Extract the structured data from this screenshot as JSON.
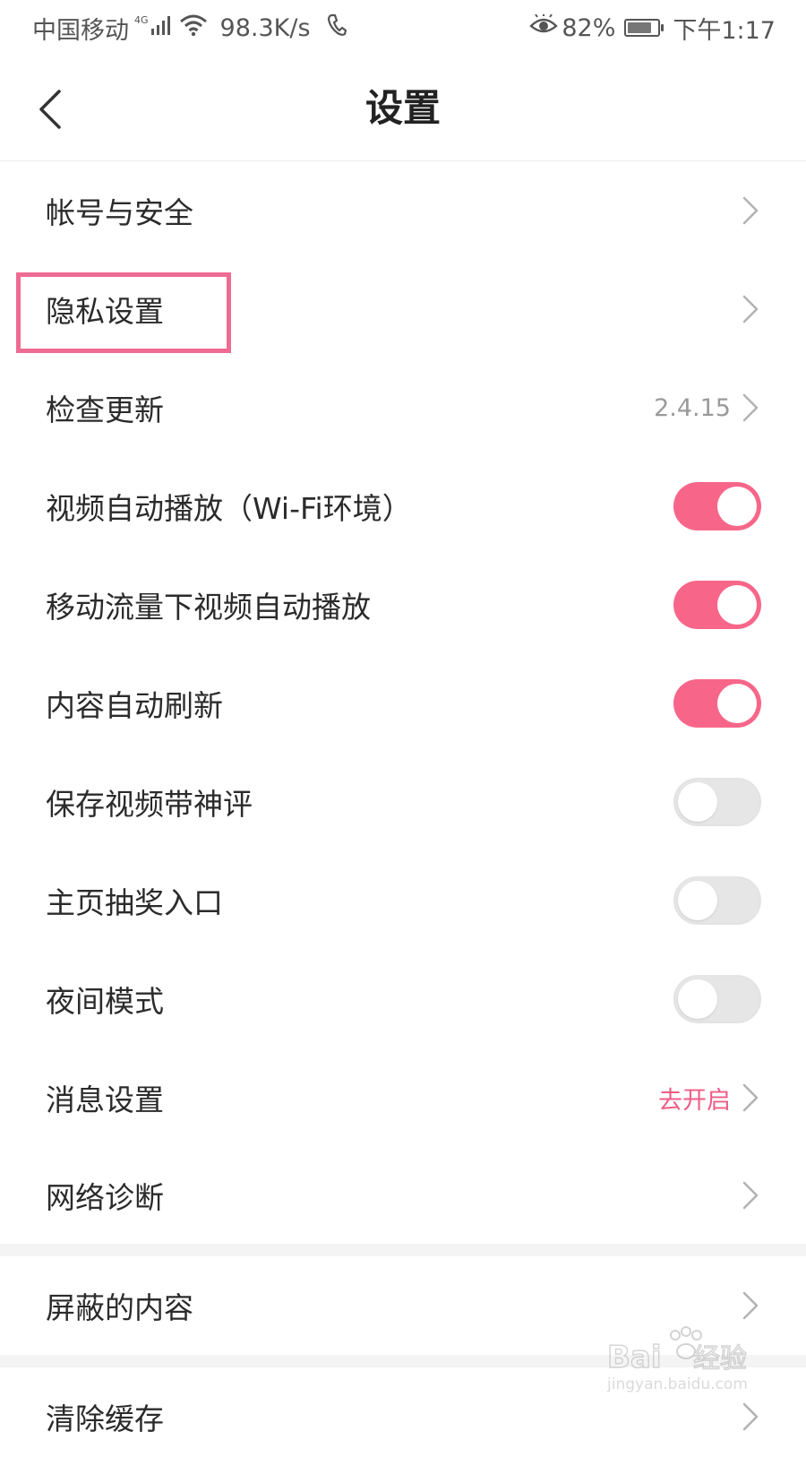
{
  "status_bar": {
    "carrier": "中国移动",
    "network_badge": "4G",
    "speed": "98.3K/s",
    "battery": "82%",
    "battery_level": 0.82,
    "time": "下午1:17"
  },
  "header": {
    "title": "设置"
  },
  "settings": {
    "account": {
      "label": "帐号与安全"
    },
    "privacy": {
      "label": "隐私设置"
    },
    "update": {
      "label": "检查更新",
      "value": "2.4.15"
    },
    "autoplay_wifi": {
      "label": "视频自动播放（Wi-Fi环境）",
      "enabled": true
    },
    "autoplay_mobile": {
      "label": "移动流量下视频自动播放",
      "enabled": true
    },
    "auto_refresh": {
      "label": "内容自动刷新",
      "enabled": true
    },
    "save_with_comments": {
      "label": "保存视频带神评",
      "enabled": false
    },
    "lottery_entry": {
      "label": "主页抽奖入口",
      "enabled": false
    },
    "night_mode": {
      "label": "夜间模式",
      "enabled": false
    },
    "notifications": {
      "label": "消息设置",
      "value": "去开启"
    },
    "network_diagnosis": {
      "label": "网络诊断"
    },
    "blocked_content": {
      "label": "屏蔽的内容"
    },
    "clear_cache": {
      "label": "清除缓存"
    }
  },
  "colors": {
    "accent": "#f76689",
    "accent_text": "#ee5d86",
    "highlight": "#ee6c94",
    "toggle_off": "#e6e6e6"
  },
  "icons": {
    "back": "chevron-left-icon",
    "row_arrow": "chevron-right-icon",
    "signal": "signal-bars-icon",
    "wifi": "wifi-icon",
    "phone": "phone-icon",
    "eye": "eye-icon",
    "battery": "battery-icon"
  },
  "watermark": {
    "brand": "Baidu经验",
    "url": "jingyan.baidu.com"
  }
}
